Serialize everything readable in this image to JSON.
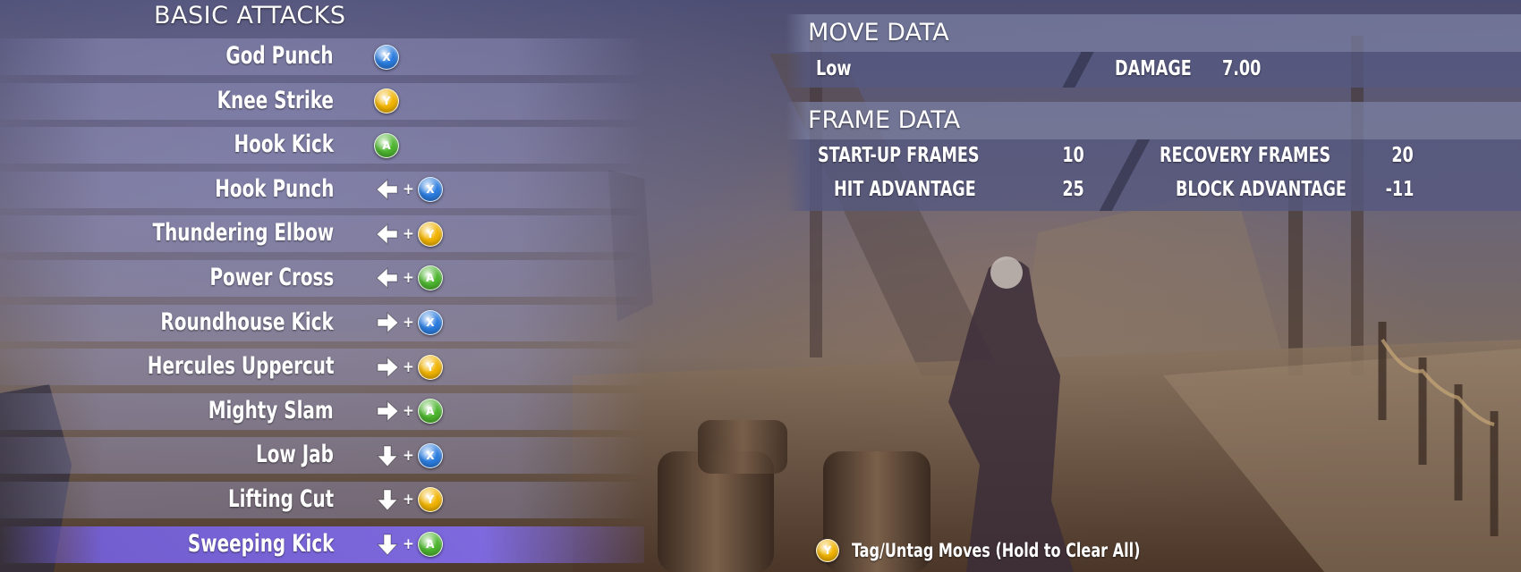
{
  "section_title": "BASIC ATTACKS",
  "buttons": {
    "X": {
      "glyph": "X",
      "color": "#2b7de0"
    },
    "Y": {
      "glyph": "Y",
      "color": "#f2b400"
    },
    "A": {
      "glyph": "A",
      "color": "#4db62f"
    }
  },
  "attacks": [
    {
      "name": "God Punch",
      "direction": "",
      "button": "X",
      "selected": false
    },
    {
      "name": "Knee Strike",
      "direction": "",
      "button": "Y",
      "selected": false
    },
    {
      "name": "Hook Kick",
      "direction": "",
      "button": "A",
      "selected": false
    },
    {
      "name": "Hook Punch",
      "direction": "back",
      "button": "X",
      "selected": false
    },
    {
      "name": "Thundering Elbow",
      "direction": "back",
      "button": "Y",
      "selected": false
    },
    {
      "name": "Power Cross",
      "direction": "back",
      "button": "A",
      "selected": false
    },
    {
      "name": "Roundhouse Kick",
      "direction": "forward",
      "button": "X",
      "selected": false
    },
    {
      "name": "Hercules Uppercut",
      "direction": "forward",
      "button": "Y",
      "selected": false
    },
    {
      "name": "Mighty Slam",
      "direction": "forward",
      "button": "A",
      "selected": false
    },
    {
      "name": "Low Jab",
      "direction": "down",
      "button": "X",
      "selected": false
    },
    {
      "name": "Lifting Cut",
      "direction": "down",
      "button": "Y",
      "selected": false
    },
    {
      "name": "Sweeping Kick",
      "direction": "down",
      "button": "A",
      "selected": true
    }
  ],
  "plus_symbol": "+",
  "move_data": {
    "title": "MOVE DATA",
    "height": "Low",
    "damage_label": "DAMAGE",
    "damage_value": "7.00"
  },
  "frame_data": {
    "title": "FRAME DATA",
    "startup_label": "START-UP FRAMES",
    "startup_value": "10",
    "hit_adv_label": "HIT ADVANTAGE",
    "hit_adv_value": "25",
    "recovery_label": "RECOVERY FRAMES",
    "recovery_value": "20",
    "block_adv_label": "BLOCK ADVANTAGE",
    "block_adv_value": "-11"
  },
  "footer": {
    "button": "Y",
    "text": "Tag/Untag Moves (Hold to Clear All)"
  }
}
